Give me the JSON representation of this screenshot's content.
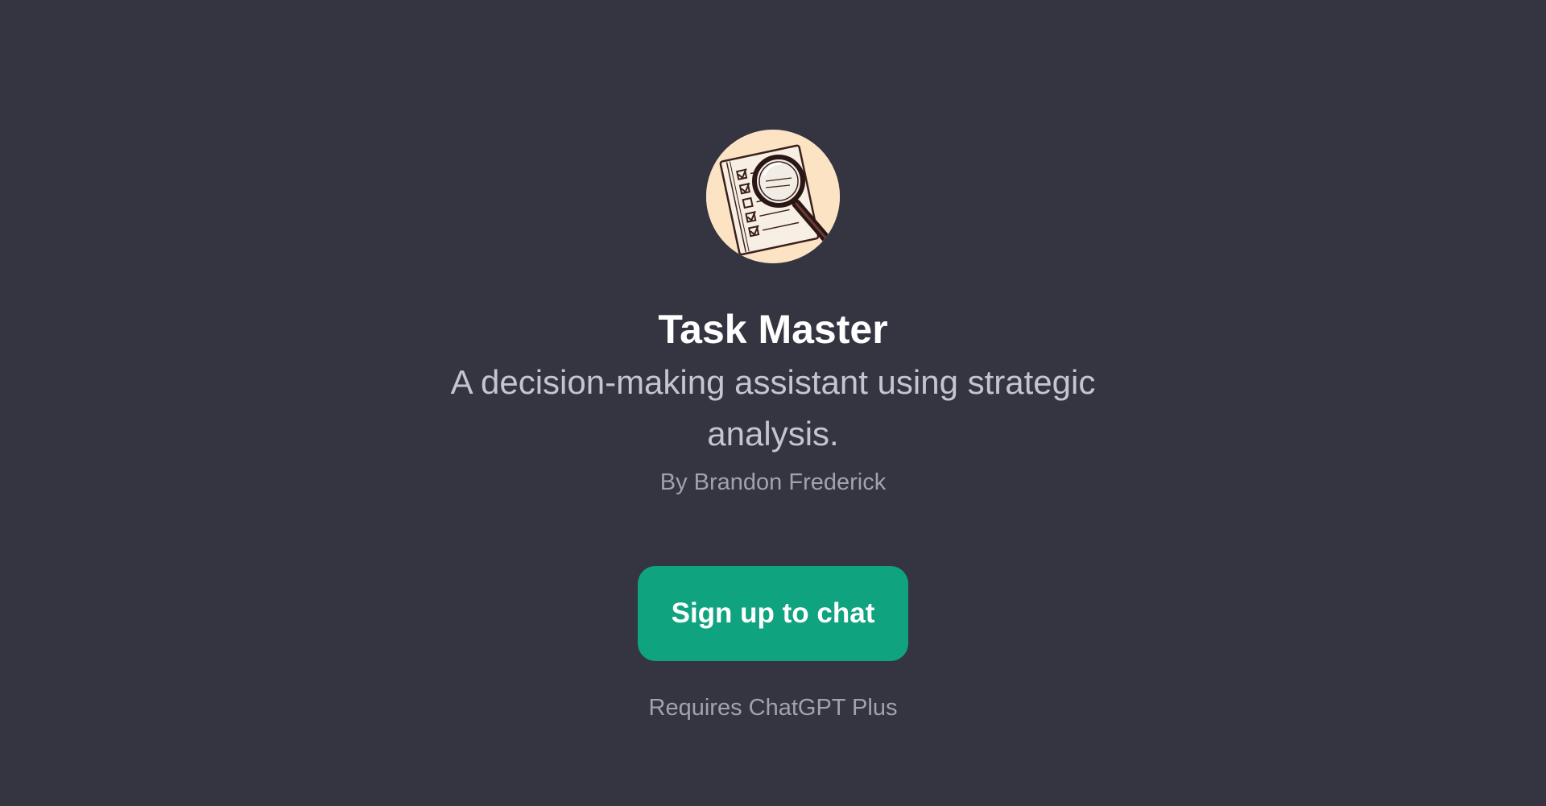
{
  "gpt": {
    "avatar_icon": "notepad-checklist-magnifier-icon",
    "name": "Task Master",
    "description": "A decision-making assistant using strategic analysis.",
    "author": "By Brandon Frederick"
  },
  "actions": {
    "signup_label": "Sign up to chat"
  },
  "footer": {
    "requirement": "Requires ChatGPT Plus"
  },
  "colors": {
    "background": "#343541",
    "accent": "#10a37f",
    "title": "#ffffff",
    "description": "#c5c5d2",
    "muted": "#a2a2ad"
  }
}
